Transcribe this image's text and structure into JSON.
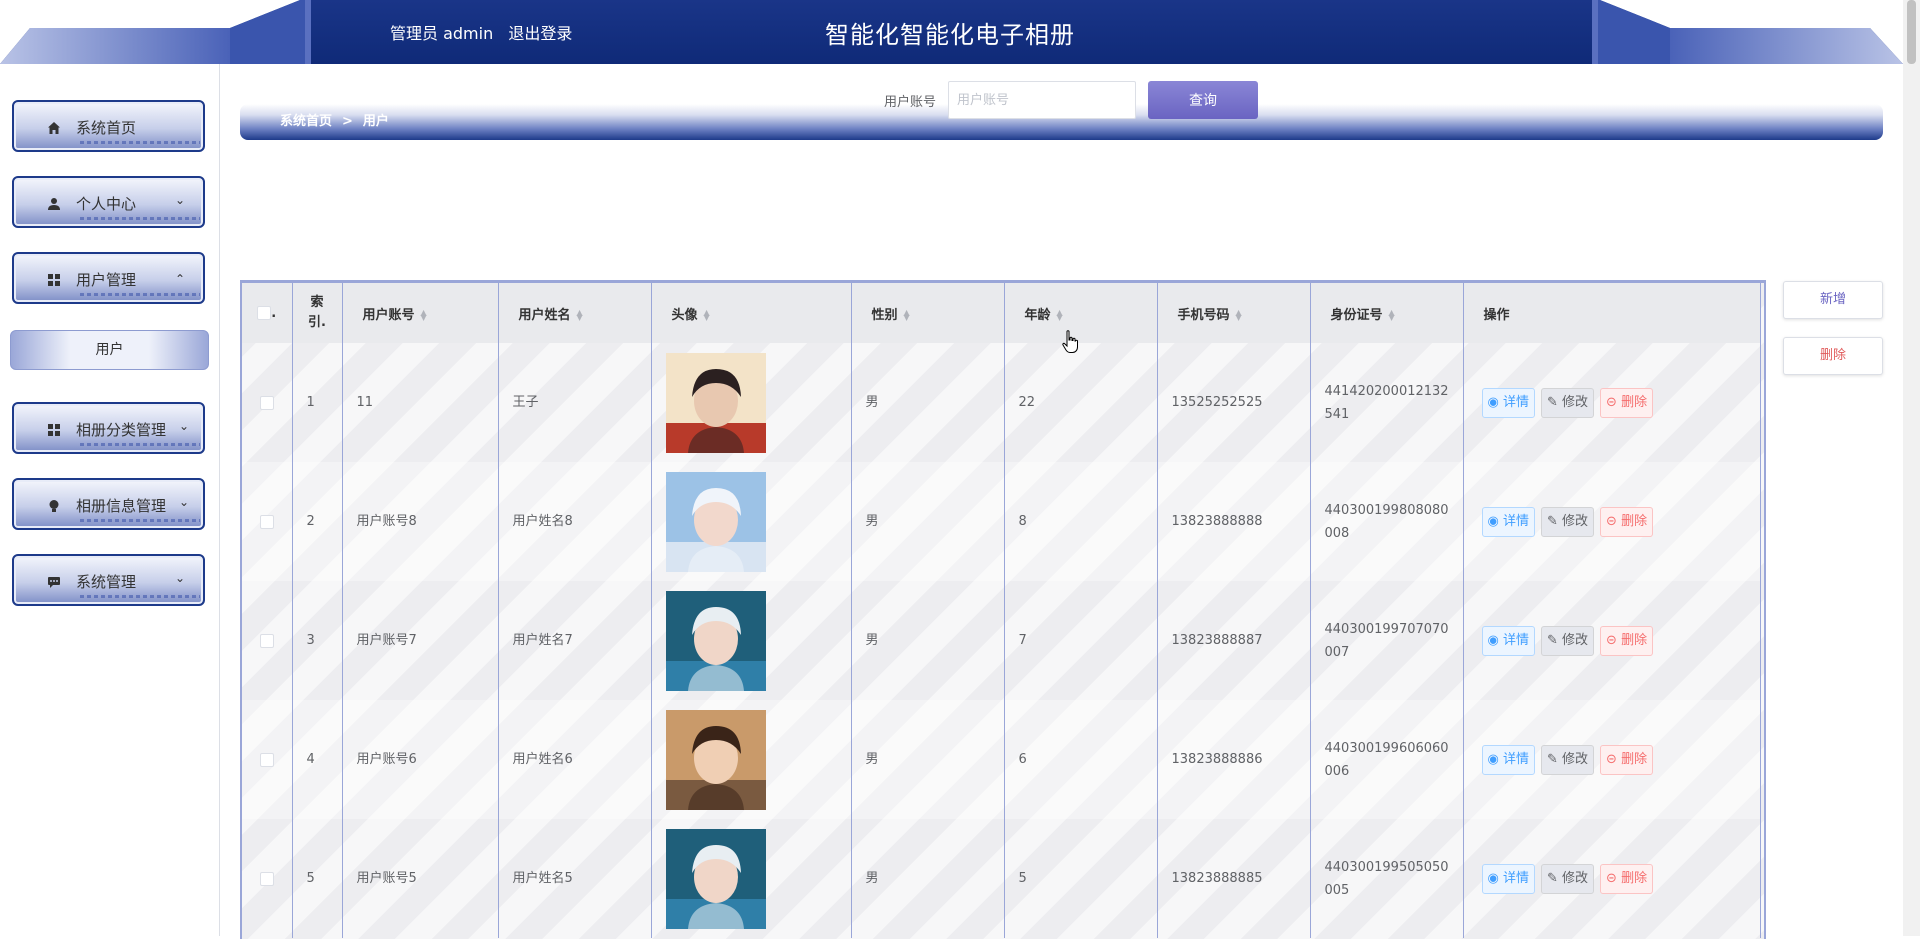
{
  "header": {
    "role_label": "管理员 admin",
    "logout_label": "退出登录",
    "site_title": "智能化智能化电子相册"
  },
  "sidebar": {
    "items": [
      {
        "label": "系统首页",
        "icon": "home-icon",
        "expanded": false
      },
      {
        "label": "个人中心",
        "icon": "user-icon",
        "expanded": false
      },
      {
        "label": "用户管理",
        "icon": "grid-icon",
        "expanded": true
      },
      {
        "label": "相册分类管理",
        "icon": "grid-icon",
        "expanded": false
      },
      {
        "label": "相册信息管理",
        "icon": "bulb-icon",
        "expanded": false
      },
      {
        "label": "系统管理",
        "icon": "chat-icon",
        "expanded": false
      }
    ],
    "submenu": {
      "label": "用户"
    }
  },
  "search": {
    "label": "用户账号",
    "placeholder": "用户账号",
    "button_label": "查询"
  },
  "breadcrumb": {
    "home": "系统首页",
    "separator": ">",
    "current": "用户"
  },
  "actions": {
    "add_label": "新增",
    "delete_label": "删除"
  },
  "table": {
    "columns": [
      "索引.",
      "用户账号",
      "用户姓名",
      "头像",
      "性别",
      "年龄",
      "手机号码",
      "身份证号",
      "操作"
    ],
    "index_header_line1": "索",
    "index_header_line2": "引.",
    "select_all_label": ".",
    "row_actions": {
      "detail": "详情",
      "edit": "修改",
      "delete": "删除"
    },
    "rows": [
      {
        "index": "1",
        "account": "11",
        "name": "王子",
        "gender": "男",
        "age": "22",
        "phone": "13525252525",
        "id_card": "441420200012132541"
      },
      {
        "index": "2",
        "account": "用户账号8",
        "name": "用户姓名8",
        "gender": "男",
        "age": "8",
        "phone": "13823888888",
        "id_card": "440300199808080008"
      },
      {
        "index": "3",
        "account": "用户账号7",
        "name": "用户姓名7",
        "gender": "男",
        "age": "7",
        "phone": "13823888887",
        "id_card": "440300199707070007"
      },
      {
        "index": "4",
        "account": "用户账号6",
        "name": "用户姓名6",
        "gender": "男",
        "age": "6",
        "phone": "13823888886",
        "id_card": "440300199606060006"
      },
      {
        "index": "5",
        "account": "用户账号5",
        "name": "用户姓名5",
        "gender": "男",
        "age": "5",
        "phone": "13823888885",
        "id_card": "440300199505050005"
      }
    ]
  },
  "colors": {
    "header_blue": "#1d3a8a",
    "accent_purple": "#6a64c2"
  }
}
